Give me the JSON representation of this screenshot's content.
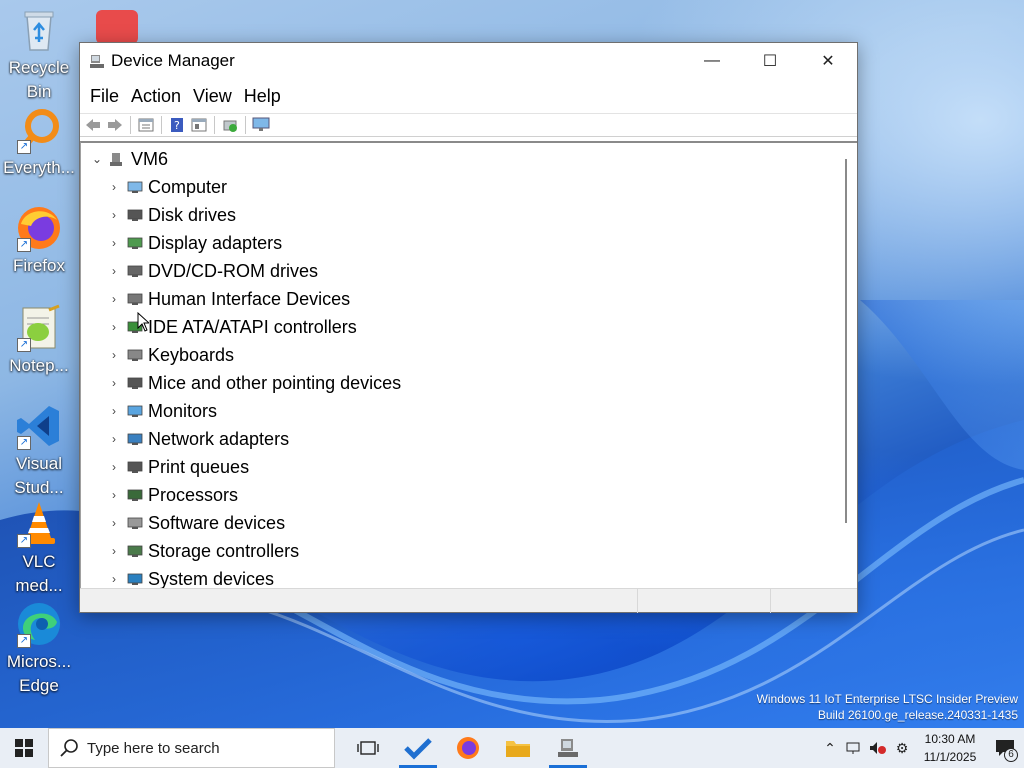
{
  "desktop": {
    "icons": [
      {
        "name": "recycle-bin",
        "label": "Recycle\nBin"
      },
      {
        "name": "everything",
        "label": "Everyth..."
      },
      {
        "name": "firefox",
        "label": "Firefox"
      },
      {
        "name": "notepad-plus",
        "label": "Notep..."
      },
      {
        "name": "visual-studio",
        "label": "Visual\nStud..."
      },
      {
        "name": "vlc",
        "label": "VLC\nmed..."
      },
      {
        "name": "edge",
        "label": "Micros...\nEdge"
      }
    ],
    "watermark_line1": "Windows 11 IoT Enterprise LTSC Insider Preview",
    "watermark_line2": "Build 26100.ge_release.240331-1435"
  },
  "window": {
    "title": "Device Manager",
    "controls": {
      "minimize": "—",
      "maximize": "☐",
      "close": "✕"
    },
    "menu": [
      "File",
      "Action",
      "View",
      "Help"
    ],
    "toolbar_icons": [
      "back-icon",
      "forward-icon",
      "properties-icon",
      "help-icon",
      "update-driver-icon",
      "scan-hardware-icon",
      "monitor-icon"
    ],
    "tree": {
      "root": "VM6",
      "nodes": [
        {
          "label": "Computer",
          "icon": "computer-icon"
        },
        {
          "label": "Disk drives",
          "icon": "disk-drive-icon"
        },
        {
          "label": "Display adapters",
          "icon": "display-adapter-icon"
        },
        {
          "label": "DVD/CD-ROM drives",
          "icon": "dvd-drive-icon"
        },
        {
          "label": "Human Interface Devices",
          "icon": "hid-icon"
        },
        {
          "label": "IDE ATA/ATAPI controllers",
          "icon": "ide-controller-icon"
        },
        {
          "label": "Keyboards",
          "icon": "keyboard-icon"
        },
        {
          "label": "Mice and other pointing devices",
          "icon": "mouse-icon"
        },
        {
          "label": "Monitors",
          "icon": "monitor-icon"
        },
        {
          "label": "Network adapters",
          "icon": "network-adapter-icon"
        },
        {
          "label": "Print queues",
          "icon": "printer-icon"
        },
        {
          "label": "Processors",
          "icon": "processor-icon"
        },
        {
          "label": "Software devices",
          "icon": "software-device-icon"
        },
        {
          "label": "Storage controllers",
          "icon": "storage-controller-icon"
        },
        {
          "label": "System devices",
          "icon": "system-device-icon"
        }
      ]
    }
  },
  "taskbar": {
    "search_placeholder": "Type here to search",
    "apps": [
      "task-view",
      "todo",
      "firefox",
      "file-explorer",
      "device-manager"
    ],
    "clock_time": "10:30 AM",
    "clock_date": "11/1/2025",
    "notification_count": "6"
  },
  "colors": {
    "accent": "#1a6fd6",
    "taskbar_bg": "#e9eef5"
  }
}
